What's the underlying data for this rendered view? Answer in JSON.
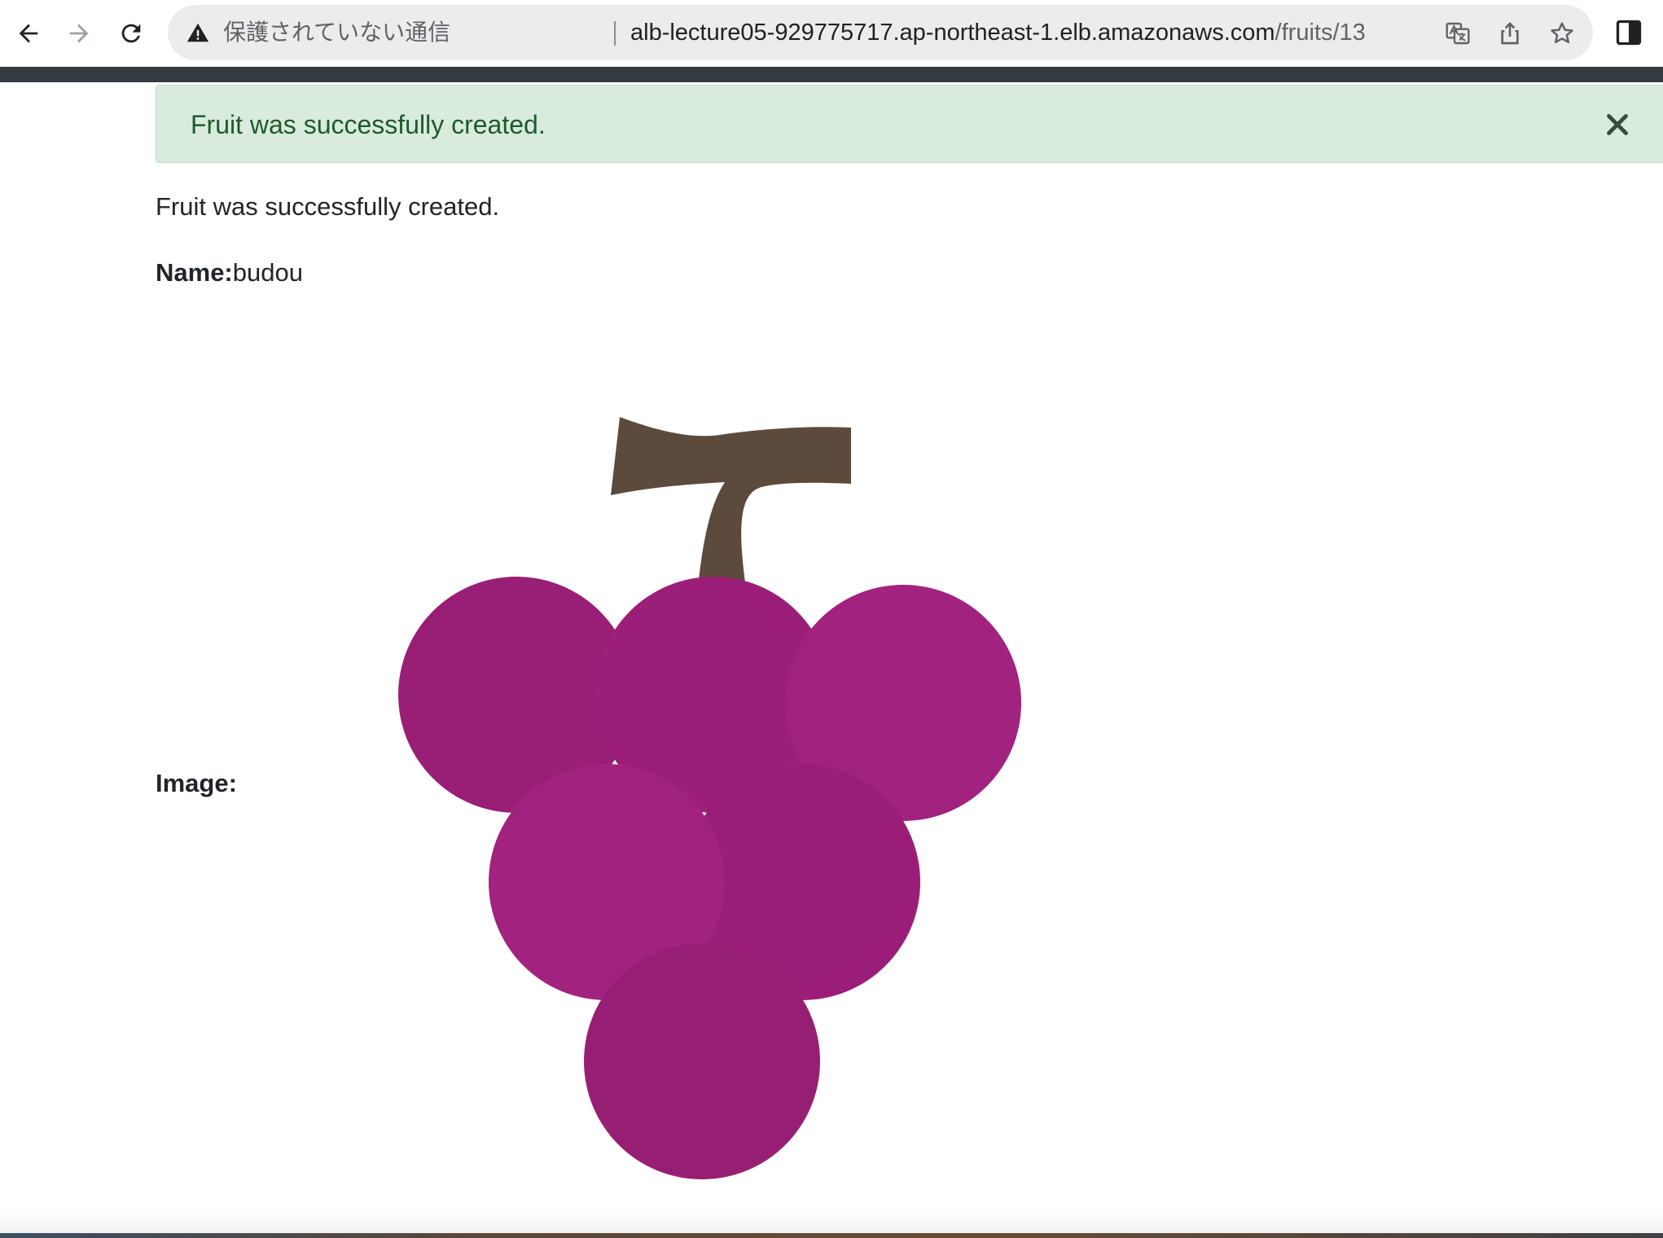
{
  "browser": {
    "security_label": "保護されていない通信",
    "url_host": "alb-lecture05-929775717.ap-northeast-1.elb.amazonaws.com",
    "url_path": "/fruits/13",
    "icons": [
      "back-arrow-icon",
      "forward-arrow-icon",
      "reload-icon",
      "warning-icon",
      "translate-icon",
      "share-icon",
      "bookmark-star-icon",
      "side-panel-icon"
    ]
  },
  "alert": {
    "message": "Fruit was successfully created.",
    "close_glyph": "×"
  },
  "page": {
    "notice": "Fruit was successfully created.",
    "name_label": "Name:",
    "name_value": "budou",
    "image_label": "Image:"
  },
  "colors": {
    "alert_bg": "#d9ebdc",
    "alert_text": "#1e5a2e",
    "grape": "#9b1f78",
    "stem": "#5c4a3c",
    "navbar": "#343a40"
  }
}
